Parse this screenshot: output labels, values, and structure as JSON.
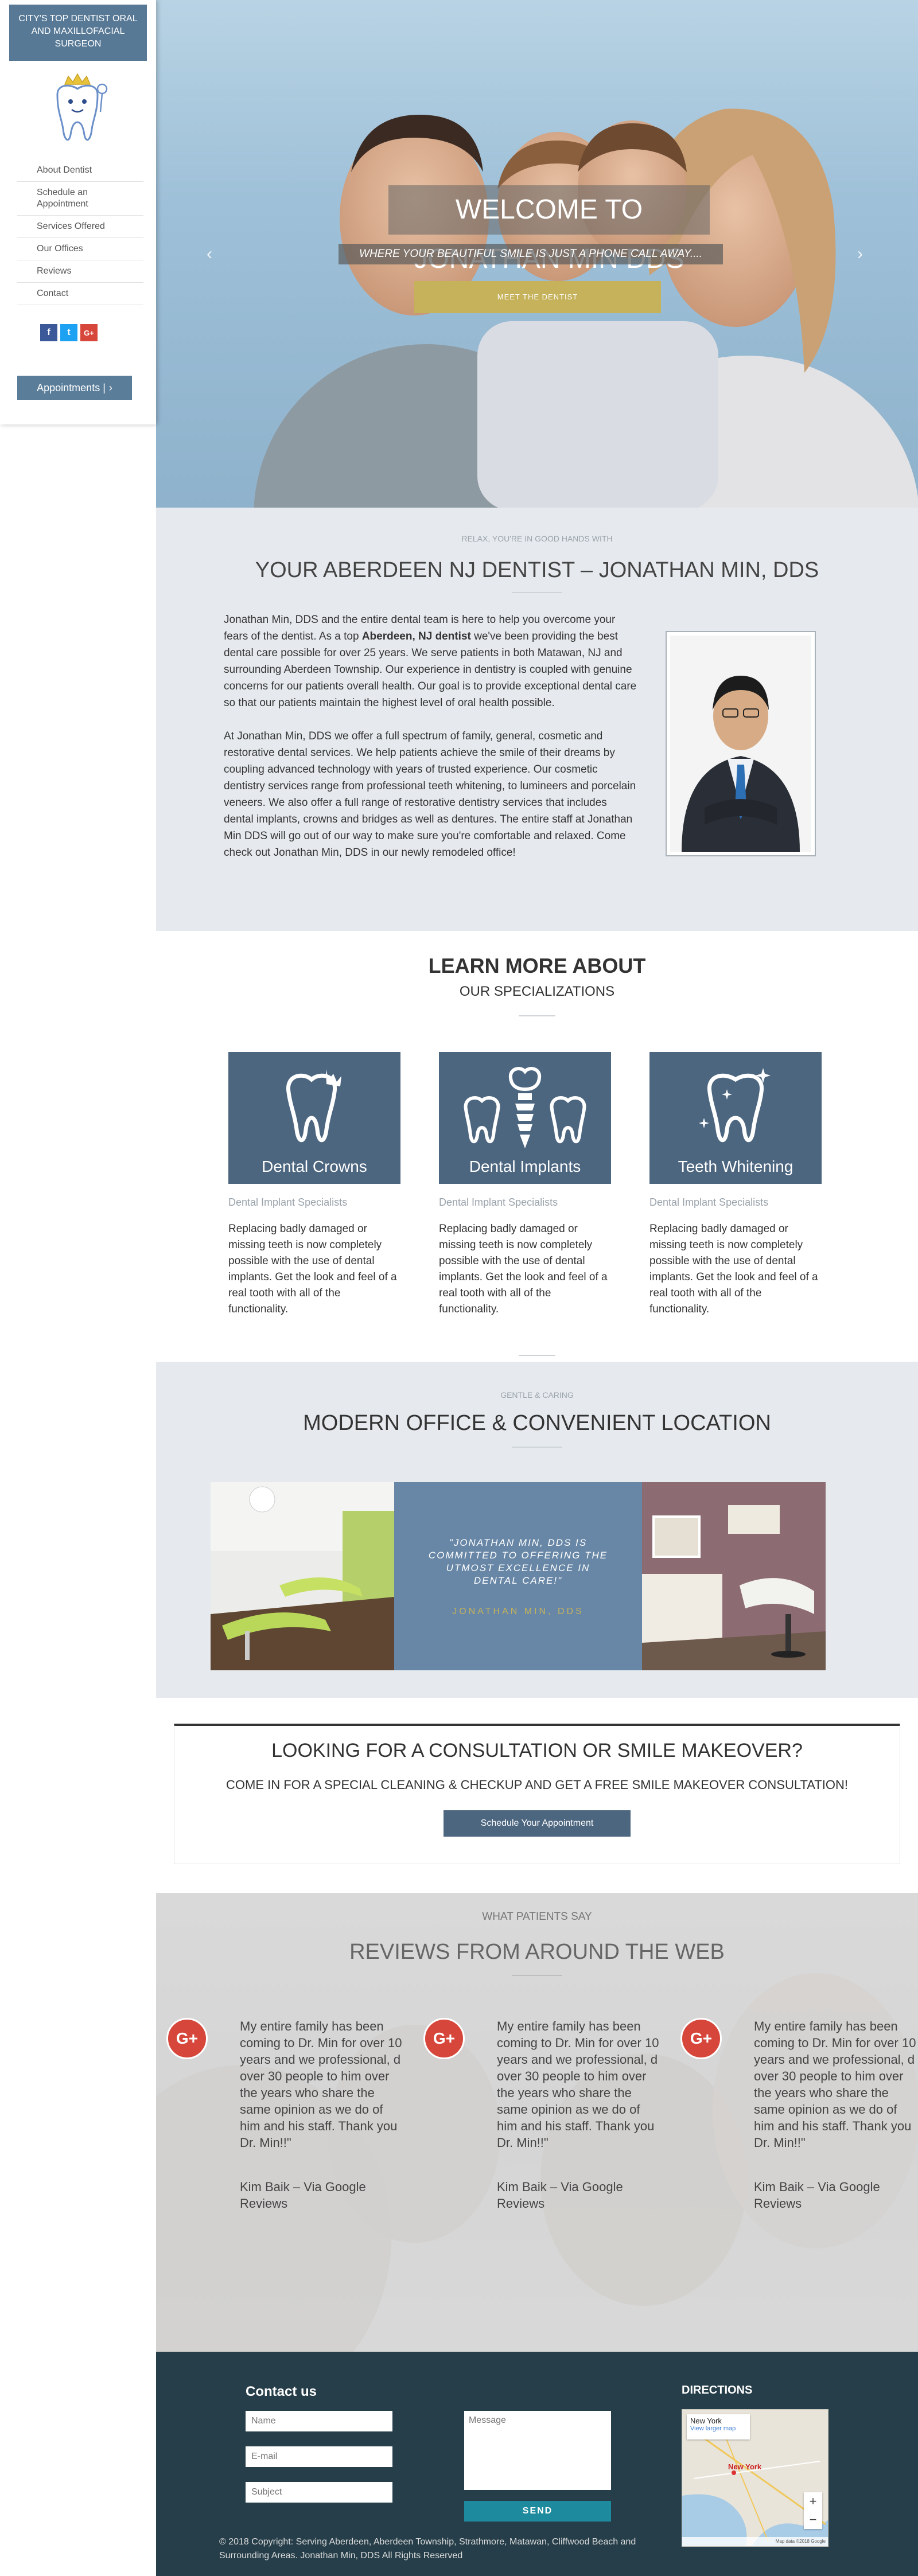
{
  "sidebar": {
    "brand": "CITY'S TOP DENTIST ORAL AND MAXILLOFACIAL SURGEON",
    "nav": [
      "About Dentist",
      "Schedule an Appointment",
      "Services Offered",
      "Our Offices",
      "Reviews",
      "Contact"
    ],
    "social": [
      {
        "icon": "facebook-icon",
        "glyph": "f",
        "color": "#3b5998"
      },
      {
        "icon": "twitter-icon",
        "glyph": "t",
        "color": "#1da1f2"
      },
      {
        "icon": "google-plus-icon",
        "glyph": "G+",
        "color": "#d7463a"
      }
    ],
    "appointments_label": "Appointments |",
    "appointments_icon": "chevron-right-icon"
  },
  "hero": {
    "title": "WELCOME TO JONATHAN MIN DDS",
    "subtitle": "WHERE YOUR BEAUTIFUL SMILE IS JUST A PHONE CALL AWAY....",
    "button": "MEET THE DENTIST",
    "prev_icon": "chevron-left-icon",
    "next_icon": "chevron-right-icon"
  },
  "about": {
    "kicker": "RELAX, YOU'RE IN GOOD HANDS WITH",
    "title": "YOUR ABERDEEN NJ DENTIST – JONATHAN MIN, DDS",
    "p1_before": "Jonathan Min, DDS and the entire dental team is here to help you overcome your fears of the dentist. As a top ",
    "p1_bold": "Aberdeen, NJ dentist",
    "p1_after": " we've been providing the best dental care possible for over 25 years. We serve patients in both Matawan, NJ and surrounding Aberdeen Township. Our experience in dentistry is coupled with genuine concerns for our patients overall health. Our goal is to provide exceptional dental care so that our patients maintain the highest level of oral health possible.",
    "p2": "At Jonathan Min, DDS we offer a full spectrum of family, general, cosmetic and restorative dental services. We help patients achieve the smile of their dreams by coupling advanced technology with years of trusted experience. Our cosmetic dentistry services range from professional teeth whitening, to lumineers and porcelain veneers. We also offer a full range of restorative dentistry services that includes dental implants, crowns and bridges as well as dentures. The entire staff at Jonathan Min DDS will go out of our way to make sure you're comfortable and relaxed. Come check out Jonathan Min, DDS in our newly remodeled office!"
  },
  "specializations": {
    "title": "LEARN MORE ABOUT",
    "subtitle": "OUR SPECIALIZATIONS",
    "cards": [
      {
        "label": "Dental Crowns",
        "icon": "tooth-crown-icon",
        "kicker": "Dental Implant Specialists",
        "text": "Replacing badly damaged or missing teeth is now completely possible with the use of dental implants. Get the look and feel of a real tooth with all of the functionality."
      },
      {
        "label": "Dental Implants",
        "icon": "tooth-implant-icon",
        "kicker": "Dental Implant Specialists",
        "text": "Replacing badly damaged or missing teeth is now completely possible with the use of dental implants. Get the look and feel of a real tooth with all of the functionality."
      },
      {
        "label": "Teeth Whitening",
        "icon": "tooth-sparkle-icon",
        "kicker": "Dental Implant Specialists",
        "text": "Replacing badly damaged or missing teeth is now completely possible with the use of dental implants. Get the look and feel of a real tooth with all of the functionality."
      }
    ]
  },
  "office": {
    "kicker": "GENTLE & CARING",
    "title": "MODERN OFFICE & CONVENIENT LOCATION",
    "quote": "\"JONATHAN MIN, DDS IS COMMITTED TO OFFERING THE UTMOST EXCELLENCE IN DENTAL CARE!\"",
    "quote_author": "JONATHAN MIN, DDS"
  },
  "cta": {
    "title": "LOOKING FOR A CONSULTATION OR SMILE MAKEOVER?",
    "subtitle": "COME IN FOR A SPECIAL CLEANING & CHECKUP AND GET A FREE SMILE MAKEOVER CONSULTATION!",
    "button": "Schedule Your Appointment"
  },
  "reviews": {
    "kicker": "WHAT PATIENTS SAY",
    "title": "REVIEWS FROM AROUND THE WEB",
    "items": [
      {
        "icon": "google-plus-icon",
        "badge": "G+",
        "text": "My entire family has been coming to Dr. Min for over 10 years and we professional, d over 30 people to him over the years who share the same opinion as we do of him and his staff. Thank you Dr. Min!!\"",
        "author": "Kim Baik – Via Google Reviews"
      },
      {
        "icon": "google-plus-icon",
        "badge": "G+",
        "text": "My entire family has been coming to Dr. Min for over 10 years and we professional, d over 30 people to him over the years who share the same opinion as we do of him and his staff. Thank you Dr. Min!!\"",
        "author": "Kim Baik – Via Google Reviews"
      },
      {
        "icon": "google-plus-icon",
        "badge": "G+",
        "text": "My entire family has been coming to Dr. Min for over 10 years and we professional, d over 30 people to him over the years who share the same opinion as we do of him and his staff. Thank you Dr. Min!!\"",
        "author": "Kim Baik – Via Google Reviews"
      }
    ]
  },
  "footer": {
    "contact_title": "Contact us",
    "name_placeholder": "Name",
    "email_placeholder": "E-mail",
    "subject_placeholder": "Subject",
    "message_placeholder": "Message",
    "send_label": "SEND",
    "directions_title": "DIRECTIONS",
    "map_place": "New York",
    "map_link": "View larger map",
    "map_city_label": "New York",
    "map_zoom_in": "+",
    "map_zoom_out": "−",
    "map_credit": "Map data ©2018 Google",
    "copyright": "© 2018 Copyright: Serving Aberdeen, Aberdeen Township, Strathmore, Matawan, Cliffwood Beach and Surrounding Areas. Jonathan Min, DDS All Rights Reserved"
  },
  "colors": {
    "brand_blue": "#577996",
    "card_blue": "#4d6680",
    "gold": "#c5b25a",
    "footer_bg": "#263e49",
    "send_teal": "#1e8a9e",
    "gplus_red": "#d7463a"
  }
}
